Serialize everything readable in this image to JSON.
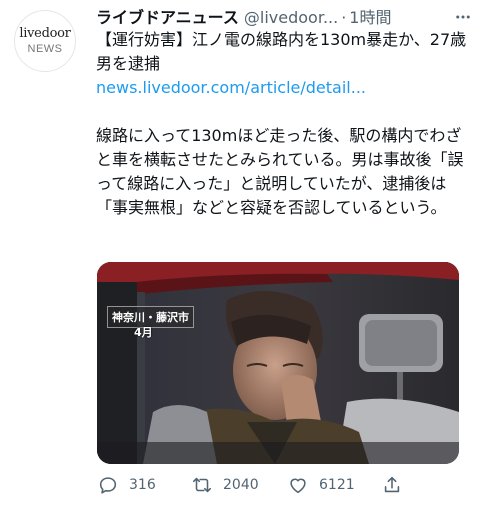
{
  "account": {
    "avatar_line1": "livedoor",
    "avatar_line2": "NEWS",
    "name": "ライブドアニュース",
    "handle": "@livedoor...",
    "separator": "·",
    "time": "1時間"
  },
  "tweet": {
    "headline": "【運行妨害】江ノ電の線路内を130m暴走か、27歳男を逮捕",
    "link": "news.livedoor.com/article/detail...",
    "body": "線路に入って130mほど走った後、駅の構内でわざと車を横転させたとみられている。男は事故後「誤って線路に入った」と説明していたが、逮捕後は「事実無根」などと容疑を否認しているという。"
  },
  "media": {
    "caption_location": "神奈川・藤沢市",
    "caption_month": "4月"
  },
  "actions": {
    "reply_count": "316",
    "retweet_count": "2040",
    "like_count": "6121"
  },
  "icons": [
    "more-icon",
    "reply-icon",
    "retweet-icon",
    "like-icon",
    "share-icon"
  ],
  "colors": {
    "link": "#1d9bf0",
    "secondary": "#536471",
    "text": "#0f1419"
  }
}
